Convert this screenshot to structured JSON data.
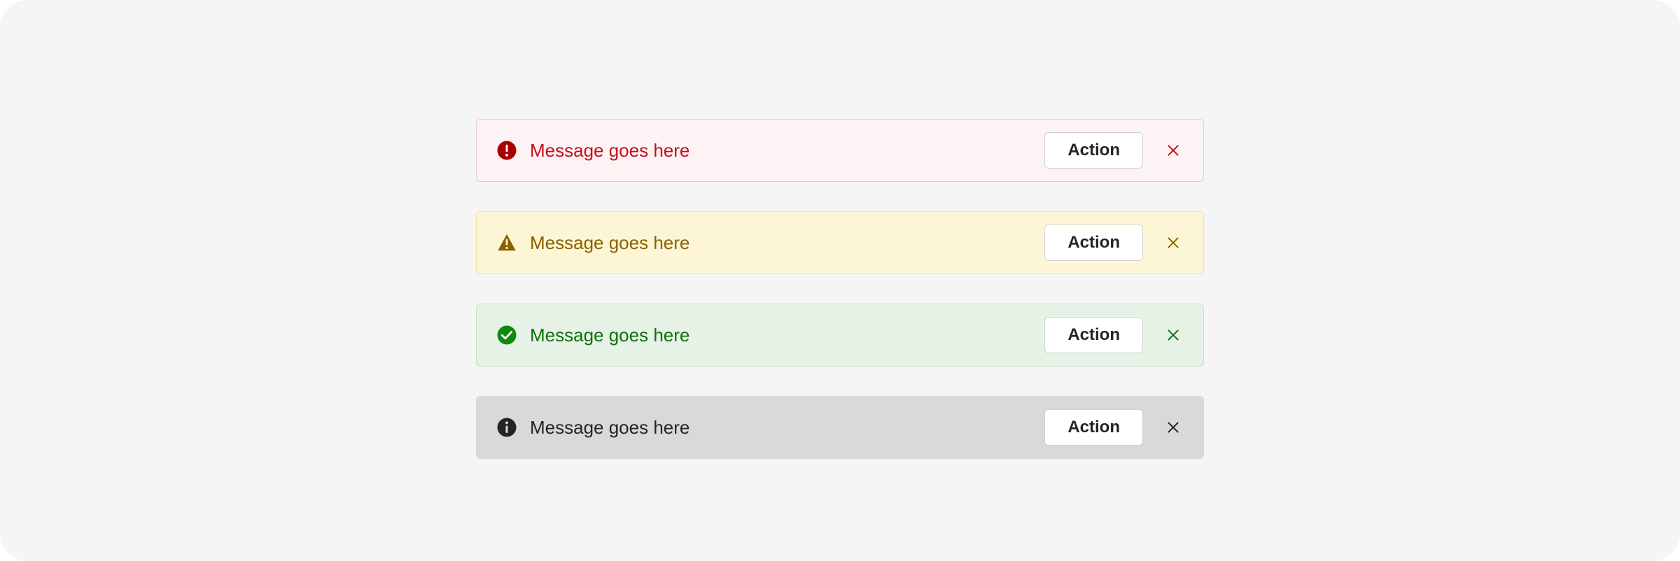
{
  "alerts": [
    {
      "variant": "error",
      "icon": "error-circle",
      "message": "Message goes here",
      "action_label": "Action",
      "colors": {
        "bg": "#fdf3f4",
        "border": "#eecacb",
        "text": "#c50f1f",
        "icon": "#a80000",
        "close": "#c50f1f"
      }
    },
    {
      "variant": "warning",
      "icon": "warning-triangle",
      "message": "Message goes here",
      "action_label": "Action",
      "colors": {
        "bg": "#fdf6d6",
        "border": "#f0e6a5",
        "text": "#8a6100",
        "icon": "#8a6100",
        "close": "#8a6100"
      }
    },
    {
      "variant": "success",
      "icon": "check-circle",
      "message": "Message goes here",
      "action_label": "Action",
      "colors": {
        "bg": "#e6f2e6",
        "border": "#c6e0c6",
        "text": "#0e700e",
        "icon": "#0e8a0e",
        "close": "#0e700e"
      }
    },
    {
      "variant": "info",
      "icon": "info-circle",
      "message": "Message goes here",
      "action_label": "Action",
      "colors": {
        "bg": "#d9d9d9",
        "border": "#d9d9d9",
        "text": "#242424",
        "icon": "#242424",
        "close": "#242424"
      }
    }
  ]
}
